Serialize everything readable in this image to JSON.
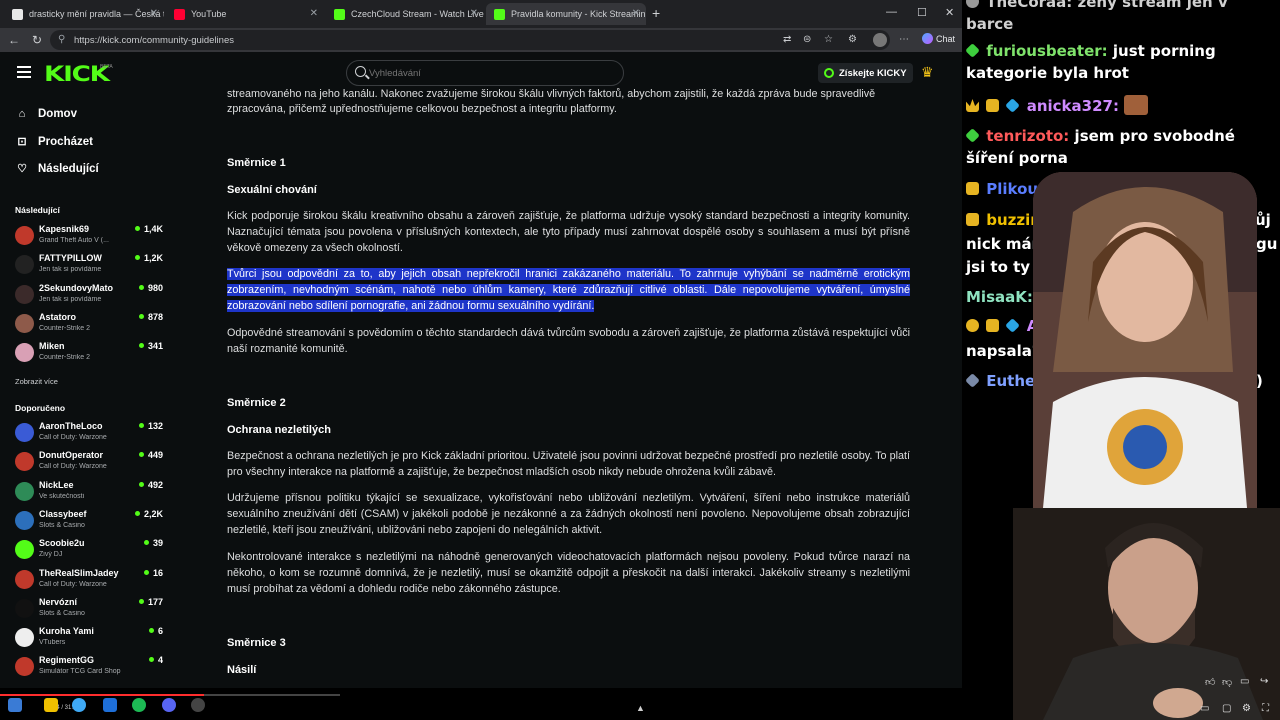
{
  "browser": {
    "tabs": [
      {
        "label": "drasticky mění pravidla — Česká t",
        "color": "#e8e8e8"
      },
      {
        "label": "YouTube",
        "color": "#ff0033"
      },
      {
        "label": "CzechCloud Stream - Watch Live o",
        "color": "#53fc18"
      },
      {
        "label": "Pravidla komunity - Kick Streamin",
        "color": "#53fc18"
      }
    ],
    "url": "https://kick.com/community-guidelines",
    "chat_label": "Chat"
  },
  "kick": {
    "logo": "KICK",
    "logo_sup": "BETA",
    "search_placeholder": "Vyhledávání",
    "kicky_label": "Získejte KICKY",
    "nav": [
      {
        "label": "Domov",
        "icon": "home-icon"
      },
      {
        "label": "Procházet",
        "icon": "compass-icon"
      },
      {
        "label": "Následující",
        "icon": "heart-icon"
      }
    ],
    "following_title": "Následující",
    "following": [
      {
        "name": "Kapesnik69",
        "game": "Grand Theft Auto V (...",
        "viewers": "1,4K",
        "avatar": "#c0392b"
      },
      {
        "name": "FATTYPILLOW",
        "game": "Jen tak si povídáme",
        "viewers": "1,2K",
        "avatar": "#222222"
      },
      {
        "name": "2SekundovyMato",
        "game": "Jen tak si povídáme",
        "viewers": "980",
        "avatar": "#3b2a2a"
      },
      {
        "name": "Astatoro",
        "game": "Counter-Strike 2",
        "viewers": "878",
        "avatar": "#8e5a4a"
      },
      {
        "name": "Miken",
        "game": "Counter-Strike 2",
        "viewers": "341",
        "avatar": "#d9a0b5"
      }
    ],
    "show_more": "Zobrazit více",
    "recommended_title": "Doporučeno",
    "recommended": [
      {
        "name": "AaronTheLoco",
        "game": "Call of Duty: Warzone",
        "viewers": "132",
        "avatar": "#3a5bd6"
      },
      {
        "name": "DonutOperator",
        "game": "Call of Duty: Warzone",
        "viewers": "449",
        "avatar": "#c0392b"
      },
      {
        "name": "NickLee",
        "game": "Ve skutečnosti",
        "viewers": "492",
        "avatar": "#2e8b57"
      },
      {
        "name": "Classybeef",
        "game": "Slots & Casino",
        "viewers": "2,2K",
        "avatar": "#2c6fbb"
      },
      {
        "name": "Scoobie2u",
        "game": "Živý DJ",
        "viewers": "39",
        "avatar": "#53fc18"
      },
      {
        "name": "TheRealSlimJadey",
        "game": "Call of Duty: Warzone",
        "viewers": "16",
        "avatar": "#c0392b"
      },
      {
        "name": "Nervózní",
        "game": "Slots & Casino",
        "viewers": "177",
        "avatar": "#111111"
      },
      {
        "name": "Kuroha Yami",
        "game": "VTubers",
        "viewers": "6",
        "avatar": "#eeeeee"
      },
      {
        "name": "RegimentGG",
        "game": "Simulátor TCG Card Shop",
        "viewers": "4",
        "avatar": "#c0392b"
      }
    ]
  },
  "article": {
    "intro_line1": "streamovaného na jeho kanálu. Nakonec zvažujeme širokou škálu vlivných faktorů, abychom zajistili, že každá zpráva bude spravedlivě",
    "intro_line2": "zpracována, přičemž upřednostňujeme celkovou bezpečnost a integritu platformy.",
    "s1_title": "Směrnice 1",
    "s1_sub": "Sexuální chování",
    "s1_p1": "Kick podporuje širokou škálu kreativního obsahu a zároveň zajišťuje, že platforma udržuje vysoký standard bezpečnosti a integrity komunity. Naznačující témata jsou povolena v příslušných kontextech, ale tyto případy musí zahrnovat dospělé osoby s souhlasem a musí být přísně věkově omezeny za všech okolností.",
    "s1_p2": "Tvůrci jsou odpovědní za to, aby jejich obsah nepřekročil hranici zakázaného materiálu. To zahrnuje vyhýbání se nadměrně erotickým zobrazením, nevhodným scénám, nahotě nebo úhlům kamery, které zdůrazňují citlivé oblasti. Dále nepovolujeme vytváření, úmyslné zobrazování nebo sdílení pornografie, ani žádnou formu sexuálního vydírání.",
    "s1_p3": "Odpovědné streamování s povědomím o těchto standardech dává tvůrcům svobodu a zároveň zajišťuje, že platforma zůstává respektující vůči naší rozmanité komunitě.",
    "s2_title": "Směrnice 2",
    "s2_sub": "Ochrana nezletilých",
    "s2_p1": "Bezpečnost a ochrana nezletilých je pro Kick základní prioritou. Uživatelé jsou povinni udržovat bezpečné prostředí pro nezletilé osoby. To platí pro všechny interakce na platformě a zajišťuje, že bezpečnost mladších osob nikdy nebude ohrožena kvůli zábavě.",
    "s2_p2": "Udržujeme přísnou politiku týkající se sexualizace, vykořisťování nebo ubližování nezletilým. Vytváření, šíření nebo instrukce materiálů sexuálního zneužívání dětí (CSAM) v jakékoli podobě je nezákonné a za žádných okolností není povoleno. Nepovolujeme obsah zobrazující nezletilé, kteří jsou zneužíváni, ubližováni nebo zapojeni do nelegálních aktivit.",
    "s2_p3": "Nekontrolované interakce s nezletilými na náhodně generovaných videochatovacích platformách nejsou povoleny. Pokud tvůrce narazí na někoho, o kom se rozumně domnívá, že je nezletilý, musí se okamžitě odpojit a přeskočit na další interakci. Jakékoliv streamy s nezletilými musí probíhat za vědomí a dohledu rodiče nebo zákonného zástupce.",
    "s3_title": "Směrnice 3",
    "s3_sub": "Násilí"
  },
  "player": {
    "timecode": "7:34 / 31:52",
    "progress": 0.6
  },
  "chat": {
    "m0_user": "TheCoraa:",
    "m0_text": "ženy stream jen v barce",
    "m1_user": "furiousbeater:",
    "m1_text": "just porning kategorie byla hrot",
    "m2_user": "anicka327:",
    "m3_user": "tenrizoto:",
    "m3_text": "jsem pro svobodné šíření porna",
    "m4_user": "Plikou",
    "m5_user": "buzzin",
    "m5_text": "nick már",
    "m5_text_right": "ůj",
    "m6_text": "jsi to ty ?",
    "m6_text_right": "gu",
    "m7_user": "MisaaK:",
    "m8_user": "A",
    "m8_text": "napsala?",
    "m9_user": "Euthe",
    "m9_text_right": ")",
    "colors": {
      "furiousbeater": "#7fe36b",
      "anicka327": "#cf8bff",
      "tenrizoto": "#ff5a5a",
      "Plikou": "#5a7dff",
      "buzzin": "#f0c000",
      "MisaaK": "#8fe3c0",
      "Euthe": "#7fa0ff",
      "TheCoraa": "#d0d0d0"
    }
  }
}
